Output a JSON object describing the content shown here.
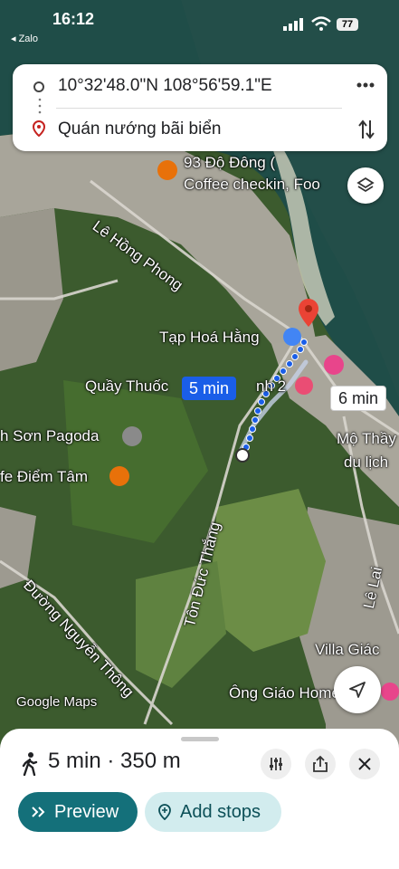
{
  "status_bar": {
    "time": "16:12",
    "back_label": "◂ Zalo",
    "battery": "77"
  },
  "directions": {
    "origin": "10°32'48.0\"N 108°56'59.1\"E",
    "destination": "Quán nướng bãi biển"
  },
  "map": {
    "route_time": "5 min",
    "alt_route_time": "6 min",
    "labels": {
      "poi_93": "93 Độ Đông (",
      "poi_93_line2": "Coffee checkin, Foo",
      "street_le_hong_phong": "Lê Hồng Phong",
      "tap_hoa": "Tạp Hoá Hằng",
      "quay_thuoc": "Quầy Thuốc",
      "quay_thuoc_end": "nh 2",
      "pagoda": "h Sơn Pagoda",
      "diem_tam": "fe Điểm Tâm",
      "mo_thay": "Mộ Thầy",
      "du_lich": "du lịch",
      "street_ton_duc_thang": "Tôn Đức Thắng",
      "street_le_lai": "Lê Lai",
      "street_nguyen_thong": "Đường Nguyễn Thông",
      "villa": "Villa Giác",
      "ong_giao": "Ông Giáo Home",
      "google_maps": "Google Maps"
    },
    "colors": {
      "route_blue": "#1a5ee8",
      "pin_red": "#ea4335",
      "accent_teal": "#14707a"
    }
  },
  "bottom_sheet": {
    "summary": "5 min · 350 m",
    "preview_label": "Preview",
    "add_stops_label": "Add stops"
  },
  "icons": [
    "walk-icon",
    "share-icon",
    "close-icon",
    "filter-icon",
    "layers-icon",
    "compass-icon",
    "swap-icon",
    "more-icon",
    "pin-icon"
  ]
}
